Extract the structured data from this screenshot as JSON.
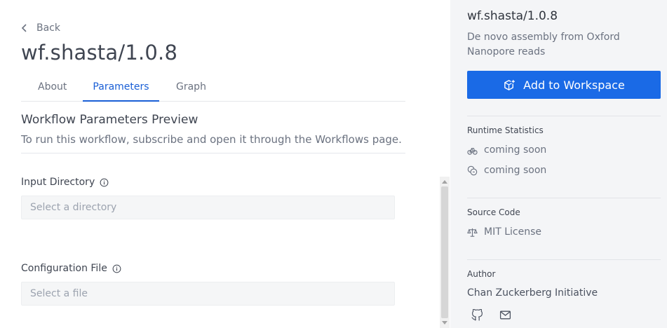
{
  "nav": {
    "back_label": "Back"
  },
  "workflow": {
    "title": "wf.shasta/1.0.8"
  },
  "tabs": [
    {
      "label": "About",
      "active": false
    },
    {
      "label": "Parameters",
      "active": true
    },
    {
      "label": "Graph",
      "active": false
    }
  ],
  "preview": {
    "title": "Workflow Parameters Preview",
    "subtitle": "To run this workflow, subscribe and open it through the Workflows page."
  },
  "fields": [
    {
      "label": "Input Directory",
      "placeholder": "Select a directory"
    },
    {
      "label": "Configuration File",
      "placeholder": "Select a file"
    }
  ],
  "sidebar": {
    "title": "wf.shasta/1.0.8",
    "description": "De novo assembly from Oxford Nanopore reads",
    "add_button": "Add to Workspace",
    "runtime_heading": "Runtime Statistics",
    "runtime_items": [
      {
        "icon": "bicycle-icon",
        "text": "coming soon"
      },
      {
        "icon": "coins-icon",
        "text": "coming soon"
      }
    ],
    "source_heading": "Source Code",
    "license": {
      "icon": "scale-icon",
      "text": "MIT License"
    },
    "author_heading": "Author",
    "author_name": "Chan Zuckerberg Initiative",
    "author_icons": [
      "github-icon",
      "mail-icon"
    ]
  },
  "colors": {
    "accent": "#1a6ae6",
    "sidebar_bg": "#f4f5f7",
    "tab_active": "#1a5fd6"
  }
}
